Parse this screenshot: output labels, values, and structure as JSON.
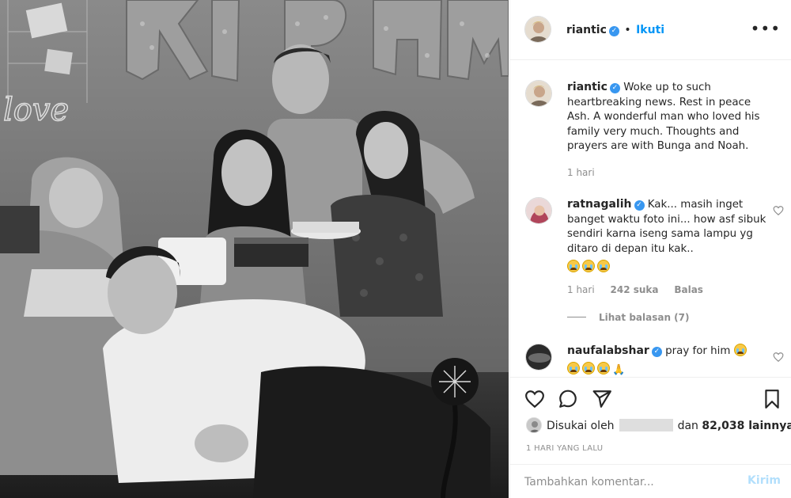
{
  "post": {
    "username": "riantic",
    "follow_label": "Ikuti",
    "dot_separator": "•",
    "more_label": "•••"
  },
  "caption": {
    "username": "riantic",
    "text": "Woke up to such heartbreaking news. Rest in peace Ash. A wonderful man who loved his family very much. Thoughts and prayers are with Bunga and Noah.",
    "time": "1 hari"
  },
  "comments": [
    {
      "username": "ratnagalih",
      "text": "Kak... masih inget banget waktu foto ini... how asf sibuk sendiri karna iseng sama lampu yg ditaro di depan itu kak..",
      "time": "1 hari",
      "likes": "242 suka",
      "reply": "Balas",
      "view_replies": "Lihat balasan (7)"
    },
    {
      "username": "naufalabshar",
      "text": "pray for him"
    }
  ],
  "likes": {
    "prefix": "Disukai oleh",
    "middle": "dan",
    "count_text": "82,038 lainnya"
  },
  "date_label": "1 HARI YANG LALU",
  "add_comment": {
    "placeholder": "Tambahkan komentar...",
    "post_label": "Kirim"
  },
  "photo": {
    "balloon_letters": [
      "R",
      "I",
      "P",
      "H",
      "M"
    ],
    "sign_text": "love"
  },
  "icons": [
    "heart-icon",
    "comment-icon",
    "share-icon",
    "bookmark-icon",
    "more-options-icon",
    "verified-icon"
  ],
  "colors": {
    "link": "#0095f6",
    "muted": "#8e8e8e",
    "verified": "#3897f0",
    "border": "#efefef"
  }
}
